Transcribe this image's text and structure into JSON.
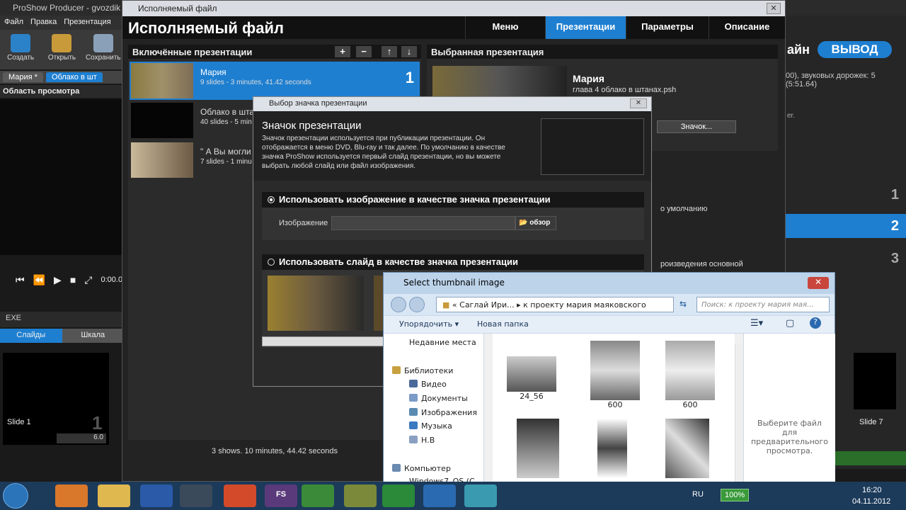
{
  "app": {
    "title": "ProShow Producer - gvozdik",
    "menu": [
      "Файл",
      "Правка",
      "Презентация"
    ],
    "toolbar": [
      "Создать",
      "Открыть",
      "Сохранить"
    ],
    "tabs": [
      "Мария *",
      "Облако в шт"
    ],
    "preview_label": "Область просмотра",
    "time": "0:00.00",
    "exe_label": "EXE",
    "slides_tabs": [
      "Слайды",
      "Шкала"
    ],
    "slide_label": "Slide 1",
    "slide_num": "1",
    "slide_dur": "6.0",
    "output_fragment": "айн",
    "output_button": "ВЫВОД",
    "right_info": "00), звуковых дорожек: 5 (5:51.64)",
    "right_rows": [
      "1",
      "2",
      "3"
    ],
    "right_slide_label": "Slide 7",
    "right_text_er": "er."
  },
  "exe_dialog": {
    "window_title": "Исполняемый файл",
    "header": "Исполняемый файл",
    "nav": [
      {
        "label": "Меню",
        "active": false
      },
      {
        "label": "Презентации",
        "active": true
      },
      {
        "label": "Параметры",
        "active": false
      },
      {
        "label": "Описание",
        "active": false
      }
    ],
    "included_header": "Включённые презентации",
    "shows": [
      {
        "name": "Мария",
        "meta": "9 slides - 3 minutes, 41.42 seconds",
        "num": "1",
        "selected": true
      },
      {
        "name": "Облако в шта",
        "meta": "40 slides - 5 min",
        "num": "",
        "selected": false
      },
      {
        "name": "\" А Вы могли С",
        "meta": "7 slides - 1 minu",
        "num": "",
        "selected": false
      }
    ],
    "footer": "3 shows. 10 minutes, 44.42 seconds",
    "selected_header": "Выбранная презентация",
    "selected_name": "Мария",
    "selected_file": "глава 4 облако в штанах.psh",
    "icon_button": "Значок...",
    "default_text": "о умолчанию",
    "playback_text": "роизведения основной"
  },
  "icon_dialog": {
    "window_title": "Выбор значка презентации",
    "title": "Значок презентации",
    "description": "Значок презентации используется при публикации презентации. Он отображается в меню DVD, Blu-ray и так далее. По умолчанию в качестве значка ProShow используется первый слайд презентации, но вы можете выбрать любой слайд или файл изображения.",
    "option_image": "Использовать изображение в качестве значка презентации",
    "image_label": "Изображение",
    "browse": "обзор",
    "option_slide": "Использовать слайд в качестве значка презентации"
  },
  "file_dialog": {
    "title": "Select thumbnail image",
    "address": [
      "Саглай Ири...",
      "к проекту мария маяковского"
    ],
    "search_placeholder": "Поиск: к проекту мария мая...",
    "organize": "Упорядочить",
    "new_folder": "Новая папка",
    "tree": [
      "Недавние места",
      "Библиотеки",
      "Видео",
      "Документы",
      "Изображения",
      "Музыка",
      "Н.В",
      "Компьютер",
      "Windows7_OS (C"
    ],
    "files": [
      "24_56",
      "600",
      "600",
      "",
      "",
      ""
    ],
    "preview_text": "Выберите файл для предварительного просмотра."
  },
  "taskbar": {
    "lang": "RU",
    "battery": "100%",
    "time": "16:20",
    "date": "04.11.2012",
    "fs_label": "FS"
  }
}
